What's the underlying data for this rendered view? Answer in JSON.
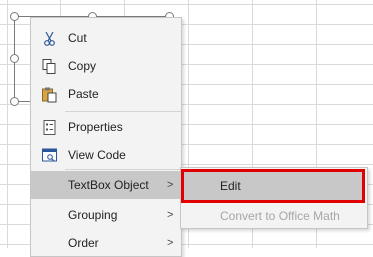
{
  "context_menu": {
    "items": [
      {
        "label": "Cut",
        "icon": "scissors-icon"
      },
      {
        "label": "Copy",
        "icon": "copy-icon"
      },
      {
        "label": "Paste",
        "icon": "paste-icon"
      },
      {
        "label": "Properties",
        "icon": "properties-icon"
      },
      {
        "label": "View Code",
        "icon": "view-code-icon"
      },
      {
        "label": "TextBox Object",
        "has_submenu": true,
        "highlighted": true
      },
      {
        "label": "Grouping",
        "has_submenu": true
      },
      {
        "label": "Order",
        "has_submenu": true
      }
    ],
    "arrow_glyph": ">"
  },
  "submenu": {
    "edit_label": "Edit",
    "convert_label": "Convert to Office Math"
  },
  "colors": {
    "highlight": "#c8c8c8",
    "annotation_box": "#e00000",
    "disabled_text": "#a6a6a6"
  }
}
